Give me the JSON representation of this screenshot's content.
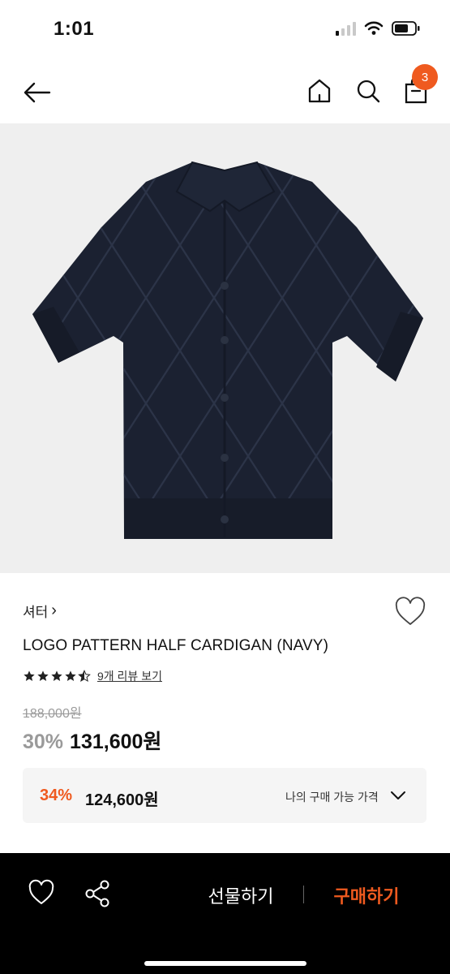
{
  "status_bar": {
    "time": "1:01",
    "battery_level": 0.7
  },
  "header": {
    "cart_count": "3",
    "icons": [
      "back-arrow-icon",
      "home-icon",
      "search-icon",
      "shopping-bag-icon"
    ]
  },
  "product": {
    "category": "셔터",
    "category_chevron": "›",
    "name": "LOGO PATTERN HALF CARDIGAN (NAVY)",
    "rating": 4.5,
    "review_link": "9개 리뷰 보기",
    "original_price": "188,000원",
    "sale_discount": "30%",
    "sale_price": "131,600원"
  },
  "my_price": {
    "discount": "34%",
    "price": "124,600원",
    "label": "나의 구매 가능 가격"
  },
  "bottom_bar": {
    "gift_label": "선물하기",
    "buy_label": "구매하기"
  },
  "colors": {
    "accent": "#ef5a1f",
    "garment": "#1b2131",
    "image_bg": "#efefef"
  }
}
